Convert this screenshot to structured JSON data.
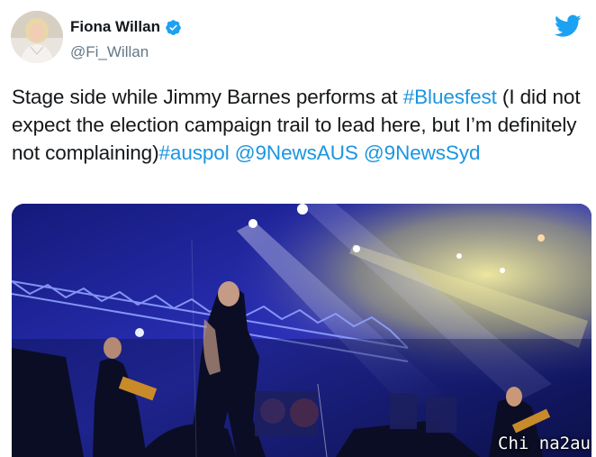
{
  "author": {
    "display_name": "Fiona Willan",
    "handle": "@Fi_Willan",
    "verified": true
  },
  "tweet": {
    "text_parts": [
      {
        "text": "Stage side while Jimmy Barnes performs at ",
        "type": "text"
      },
      {
        "text": "#Bluesfest",
        "type": "hashtag"
      },
      {
        "text": " (I did not expect the election campaign trail to lead here, but I’m definitely not complaining)",
        "type": "text"
      },
      {
        "text": "#auspol",
        "type": "hashtag"
      },
      {
        "text": " ",
        "type": "text"
      },
      {
        "text": "@9NewsAUS",
        "type": "mention"
      },
      {
        "text": " ",
        "type": "text"
      },
      {
        "text": "@9NewsSyd",
        "type": "mention"
      }
    ]
  },
  "media": {
    "kind": "photo",
    "description_icon": "concert-photo"
  },
  "watermark": "Chi na2au",
  "colors": {
    "link": "#1b95e0",
    "verified": "#1da1f2",
    "twitter_brand": "#1da1f2",
    "text": "#14171a",
    "secondary": "#657786"
  }
}
